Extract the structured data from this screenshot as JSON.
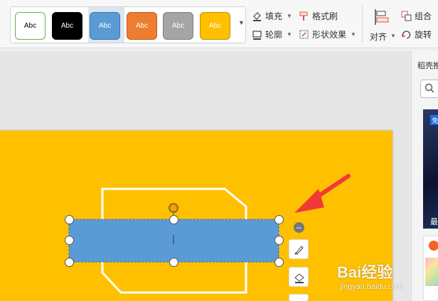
{
  "ribbon": {
    "styles": [
      {
        "label": "Abc",
        "fill": "#ffffff",
        "text": "#000000",
        "border": "#70ad47"
      },
      {
        "label": "Abc",
        "fill": "#000000",
        "text": "#ffffff",
        "border": "#000000"
      },
      {
        "label": "Abc",
        "fill": "#5b9bd5",
        "text": "#ffffff",
        "border": "#41719c"
      },
      {
        "label": "Abc",
        "fill": "#ed7d31",
        "text": "#ffffff",
        "border": "#c55a11"
      },
      {
        "label": "Abc",
        "fill": "#a5a5a5",
        "text": "#ffffff",
        "border": "#7f7f7f"
      },
      {
        "label": "Abc",
        "fill": "#ffc000",
        "text": "#ffffff",
        "border": "#bf9000"
      }
    ],
    "fill_label": "填充",
    "format_painter_label": "格式刷",
    "outline_label": "轮廓",
    "shape_effects_label": "形状效果",
    "align_label": "对齐",
    "group_label": "组合",
    "rotate_label": "旋转"
  },
  "right_pane": {
    "title": "稻壳推",
    "thumb_badge": "免",
    "thumb_caption": "最"
  },
  "watermark": {
    "brand": "Bai经验",
    "url": "jingyan.baidu.com"
  },
  "colors": {
    "slide_bg": "#ffc000",
    "selected_shape_fill": "#5b9bd5",
    "outline_shape_stroke": "#ffffff",
    "annotation_arrow": "#f03a3a"
  }
}
